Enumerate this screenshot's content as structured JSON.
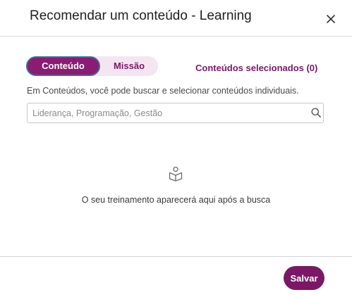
{
  "modal": {
    "title": "Recomendar um conteúdo - Learning",
    "close_icon": "close-icon"
  },
  "tabs": [
    {
      "label": "Conteúdo",
      "active": true
    },
    {
      "label": "Missão",
      "active": false
    }
  ],
  "selected_contents_label": "Conteúdos selecionados (0)",
  "help_text": "Em Conteúdos, você pode buscar e selecionar conteúdos individuais.",
  "search": {
    "placeholder": "Liderança, Programação, Gestão",
    "value": "",
    "icon": "search-icon"
  },
  "empty_state": {
    "icon": "book-icon",
    "message": "O seu treinamento aparecerá aqui após a busca"
  },
  "footer": {
    "save_label": "Salvar"
  },
  "colors": {
    "accent": "#7a1866",
    "accent_active": "#8a1c73",
    "toggle_bg": "#f3e6f2",
    "focus_ring": "#3f6c9a"
  }
}
